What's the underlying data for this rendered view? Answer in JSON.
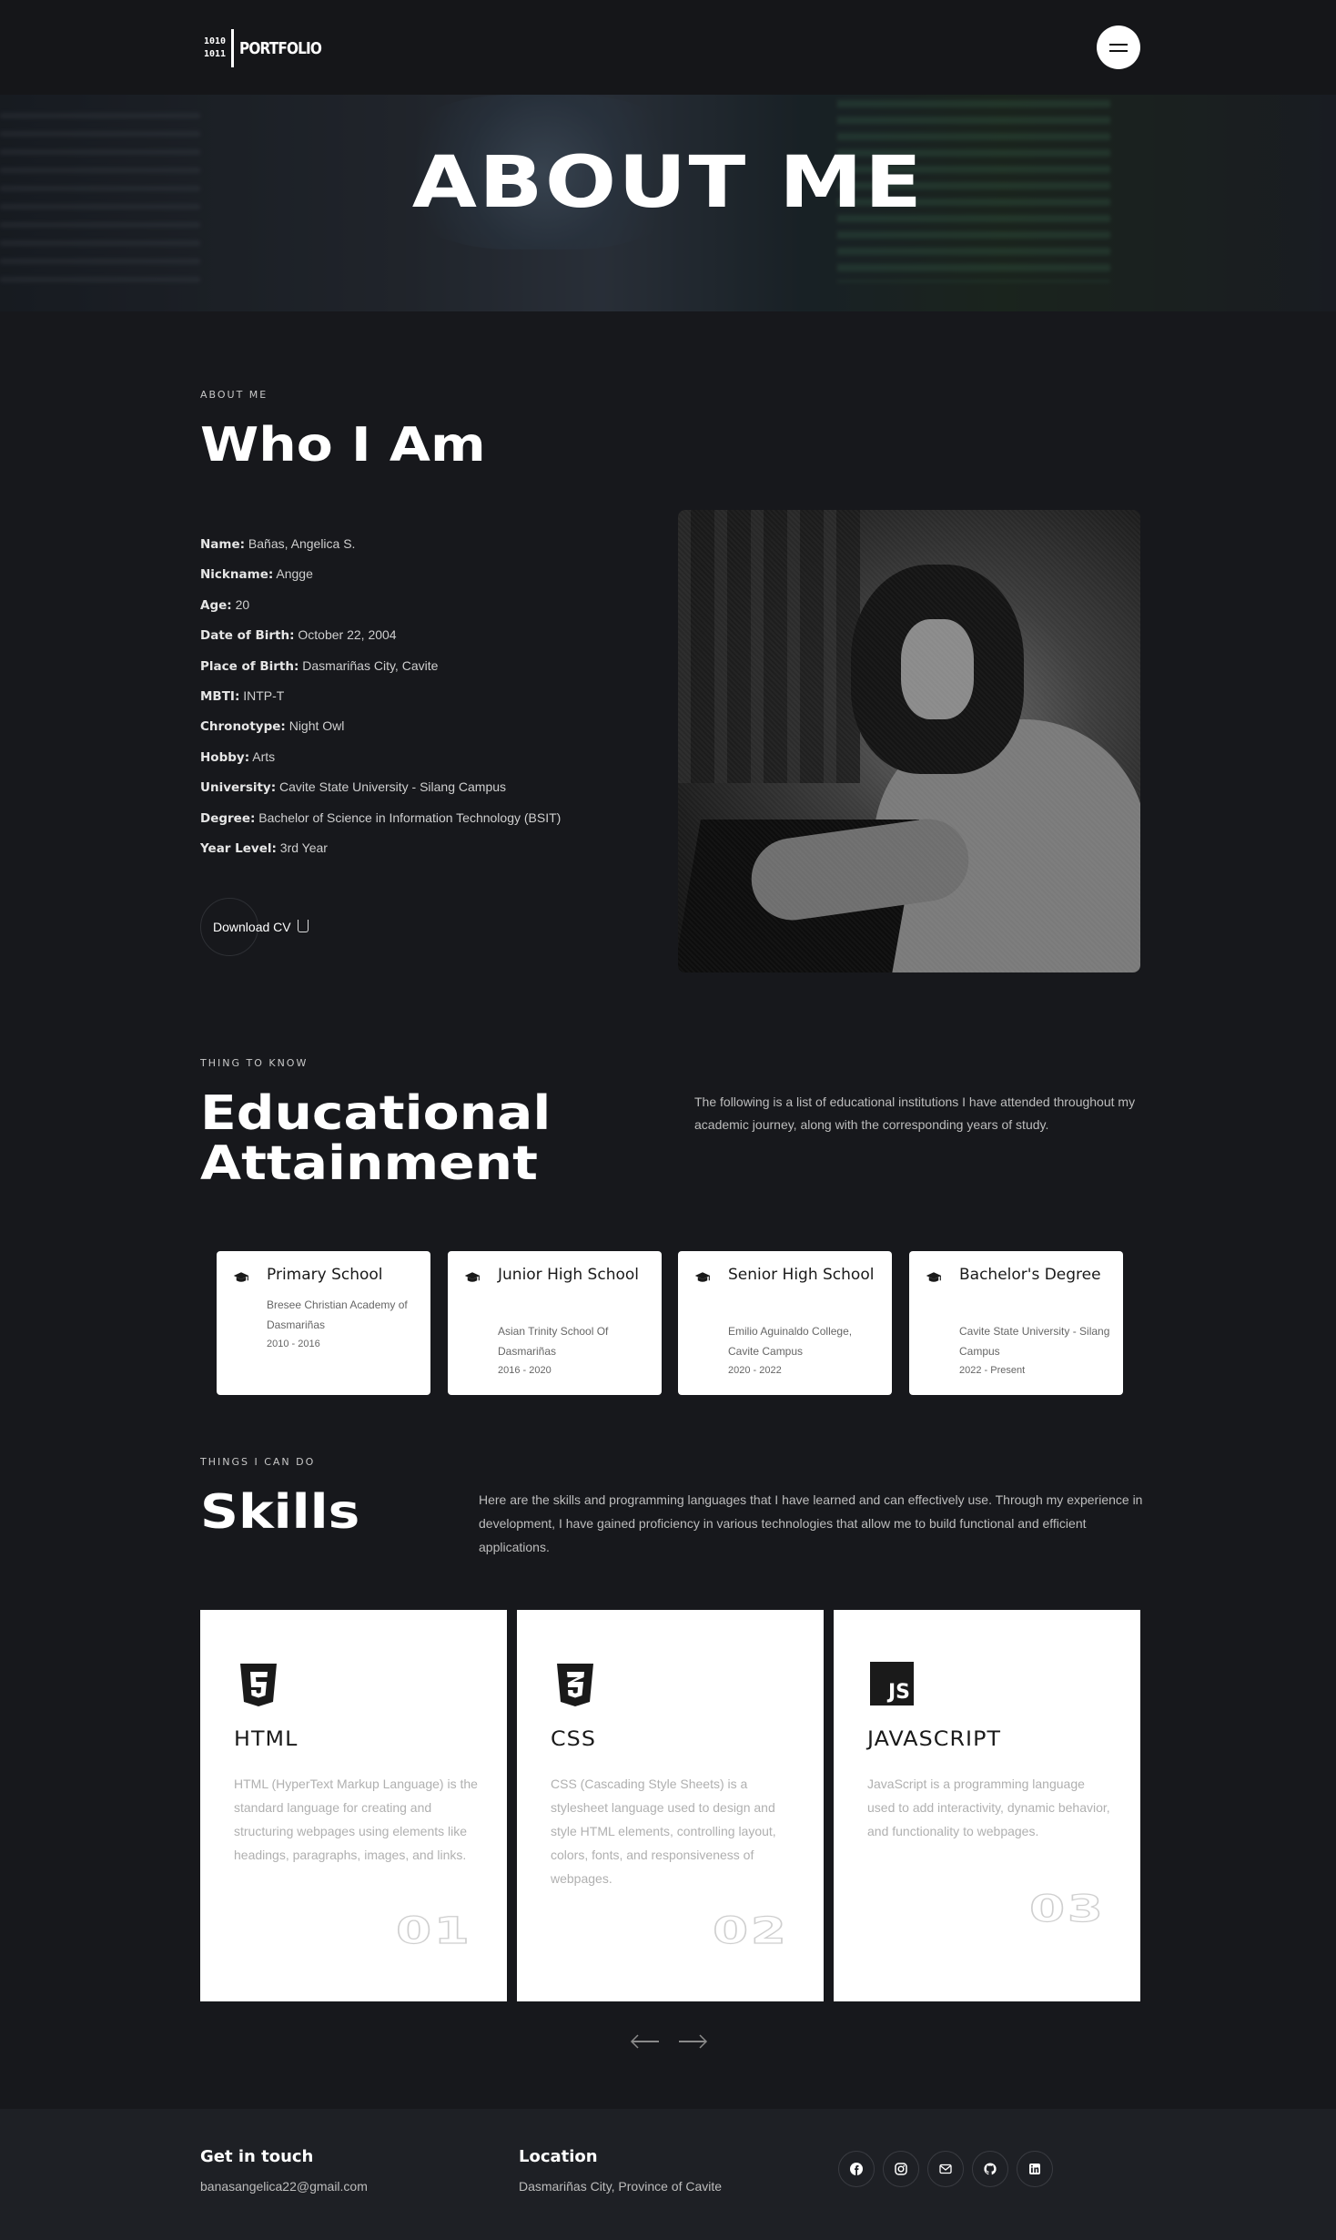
{
  "nav": {
    "logo_top": "1010",
    "logo_bottom": "1011",
    "logo_text": "PORTFOLIO"
  },
  "hero": {
    "title": "ABOUT ME"
  },
  "about": {
    "eyebrow": "ABOUT ME",
    "title": "Who I Am",
    "rows": [
      {
        "label": "Name:",
        "value": "Bañas, Angelica S."
      },
      {
        "label": "Nickname:",
        "value": "Angge"
      },
      {
        "label": "Age:",
        "value": "20"
      },
      {
        "label": "Date of Birth:",
        "value": "October 22, 2004"
      },
      {
        "label": "Place of Birth:",
        "value": "Dasmariñas City, Cavite"
      },
      {
        "label": "MBTI:",
        "value": "INTP-T"
      },
      {
        "label": "Chronotype:",
        "value": "Night Owl"
      },
      {
        "label": "Hobby:",
        "value": "Arts"
      },
      {
        "label": "University:",
        "value": "Cavite State University - Silang Campus"
      },
      {
        "label": "Degree:",
        "value": "Bachelor of Science in Information Technology (BSIT)"
      },
      {
        "label": "Year Level:",
        "value": "3rd Year"
      }
    ],
    "cv_label": "Download CV"
  },
  "education": {
    "eyebrow": "THING TO KNOW",
    "title_line1": "Educational",
    "title_line2": "Attainment",
    "description": "The following is a list of educational institutions I have attended throughout my academic journey, along with the corresponding years of study.",
    "cards": [
      {
        "title": "Primary School",
        "school": "Bresee Christian Academy of Dasmariñas",
        "years": "2010 - 2016"
      },
      {
        "title": "Junior High School",
        "school": "Asian Trinity School Of Dasmariñas",
        "years": "2016 - 2020"
      },
      {
        "title": "Senior High School",
        "school": "Emilio Aguinaldo College, Cavite Campus",
        "years": "2020 - 2022"
      },
      {
        "title": "Bachelor's Degree",
        "school": "Cavite State University - Silang Campus",
        "years": "2022 - Present"
      }
    ]
  },
  "skills": {
    "eyebrow": "THINGS I CAN DO",
    "title": "Skills",
    "description": "Here are the skills and programming languages that I have learned and can effectively use. Through my experience in development, I have gained proficiency in various technologies that allow me to build functional and efficient applications.",
    "cards": [
      {
        "icon": "html5-icon",
        "name": "HTML",
        "description": "HTML (HyperText Markup Language) is the standard language for creating and structuring webpages using elements like headings, paragraphs, images, and links.",
        "number": "01"
      },
      {
        "icon": "css3-icon",
        "name": "CSS",
        "description": "CSS (Cascading Style Sheets) is a stylesheet language used to design and style HTML elements, controlling layout, colors, fonts, and responsiveness of webpages.",
        "number": "02"
      },
      {
        "icon": "javascript-icon",
        "name": "JAVASCRIPT",
        "description": "JavaScript is a programming language used to add interactivity, dynamic behavior, and functionality to webpages.",
        "number": "03",
        "js_badge": "JS"
      }
    ]
  },
  "footer": {
    "contact_title": "Get in touch",
    "email": "banasangelica22@gmail.com",
    "location_title": "Location",
    "location": "Dasmariñas City, Province of Cavite",
    "socials": [
      "facebook-icon",
      "instagram-icon",
      "mail-icon",
      "github-icon",
      "linkedin-icon"
    ]
  },
  "colors": {
    "background": "#17181c",
    "footer": "#1e2025",
    "card": "#ffffff",
    "text": "#e8e8e8"
  }
}
